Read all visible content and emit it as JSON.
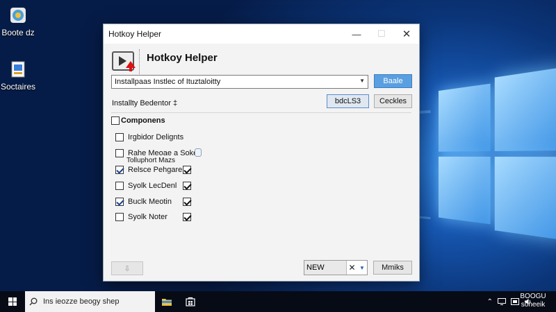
{
  "desktop": {
    "icons": [
      {
        "label": "Boote dz",
        "icon": "app-shortcut-icon"
      },
      {
        "label": "Soctaires",
        "icon": "app-shortcut-icon"
      }
    ]
  },
  "window": {
    "title": "Hotkoy Helper",
    "controls": {
      "minimize": "—",
      "maximize": "☐",
      "close": "✕"
    }
  },
  "header": {
    "heading": "Hotkoy Helper",
    "icon": "app-logo-icon"
  },
  "install": {
    "path_value": "Installpaas Instlec of Ituztaloitty",
    "browse_label": "Baale",
    "label": "Installty Bedentor ‡",
    "button_blue_label": "bdcLS3",
    "button_cookies_label": "Ceckles"
  },
  "components": {
    "group_title": "Componens",
    "sub_text": "Tolluphort Mazs",
    "items": [
      {
        "label": "Irgbidor Delignts",
        "checked": false,
        "extra_checked": null
      },
      {
        "label": "Rahe Meoae a Soken",
        "checked": false,
        "extra_checked": null
      },
      {
        "label": "Relsce Pehgarer",
        "checked": true,
        "extra_checked": true
      },
      {
        "label": "Syolk LecDenl",
        "checked": false,
        "extra_checked": true
      },
      {
        "label": "Buclk Meotin",
        "checked": true,
        "extra_checked": true
      },
      {
        "label": "Syolk Noter",
        "checked": false,
        "extra_checked": true
      }
    ]
  },
  "footer": {
    "left_button_label": "⇩",
    "combo_value": "NEW",
    "combo_clear": "✕",
    "combo_arrow": "▼",
    "right_button_label": "Mmiks"
  },
  "taskbar": {
    "search_placeholder": "Ins ieozze beogy shep",
    "tray_icons": [
      "chevron-up-icon",
      "display-icon",
      "network-icon",
      "volume-icon"
    ],
    "clock_line1": "BOOGU",
    "clock_line2": "soneeik"
  },
  "colors": {
    "accent": "#5a9fe0",
    "desktop_bg": "#0b3579",
    "taskbar_bg": "#070b16"
  }
}
